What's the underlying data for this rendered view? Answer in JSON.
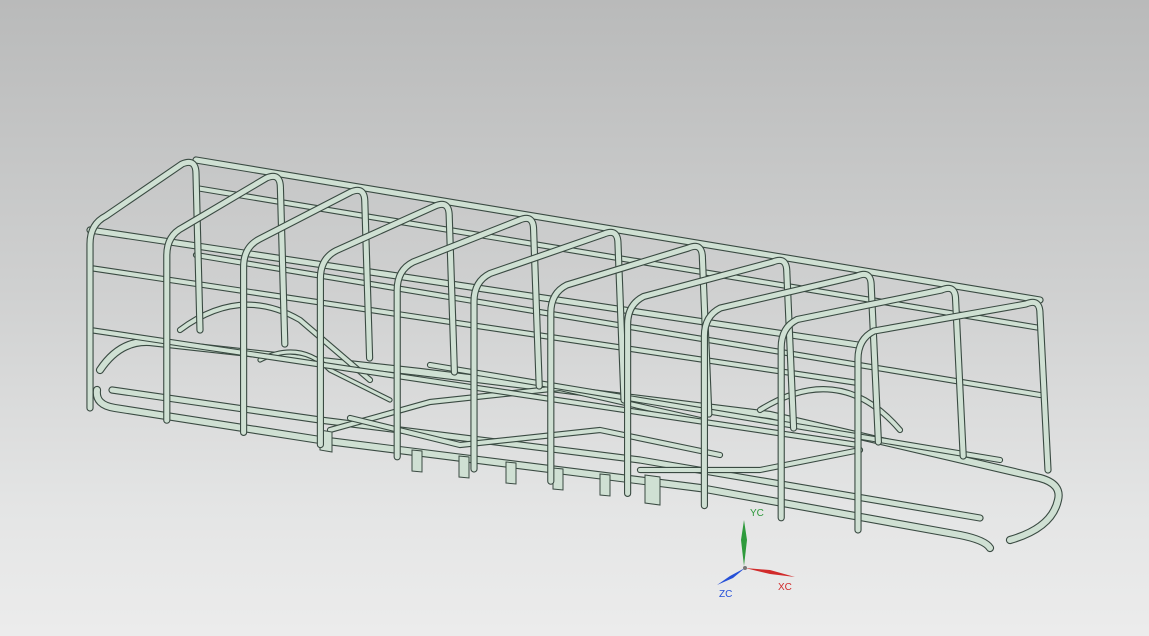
{
  "viewport": {
    "model": "tubular-space-frame-chassis",
    "colors": {
      "background_top": "#b9baba",
      "background_bottom": "#ececec",
      "tube_fill": "#cfe0d3",
      "tube_edge": "#3a4a42",
      "x_axis": "#d12b2b",
      "y_axis": "#2e9a3c",
      "z_axis": "#2550d8"
    }
  },
  "triad": {
    "x_label": "XC",
    "y_label": "YC",
    "z_label": "ZC"
  }
}
